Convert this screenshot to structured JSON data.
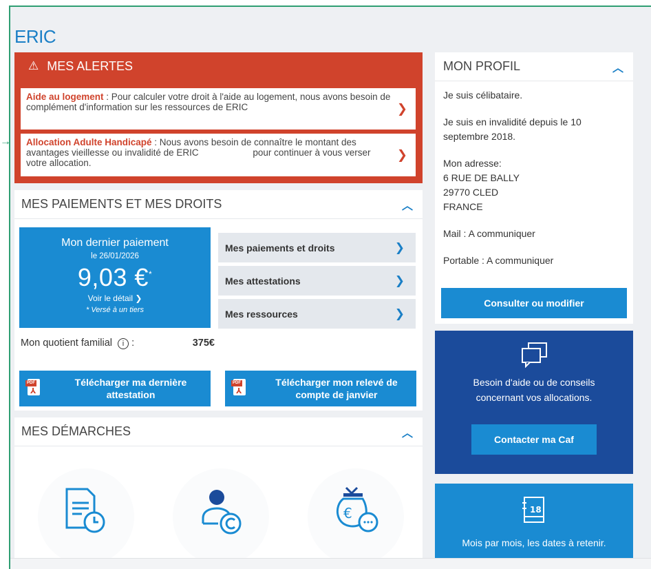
{
  "user": {
    "name": "ERIC"
  },
  "alerts": {
    "title": "MES ALERTES",
    "items": [
      {
        "title": "Aide au logement",
        "sep": " : ",
        "text": "Pour calculer votre droit à l'aide au logement, nous avons besoin de complément d'information sur les ressources de ERIC"
      },
      {
        "title": "Allocation Adulte Handicapé",
        "sep": " : ",
        "text": "Nous avons besoin de connaître le montant des avantages vieillesse ou invalidité de ERIC                     pour continuer à vous verser votre allocation."
      }
    ]
  },
  "payments": {
    "title": "MES PAIEMENTS ET MES DROITS",
    "last": {
      "label": "Mon dernier paiement",
      "date": "le 26/01/2026",
      "amount": "9,03 €",
      "marker": "*",
      "detail": "Voir le détail",
      "note": "* Versé à un tiers"
    },
    "links": [
      "Mes paiements et droits",
      "Mes attestations",
      "Mes ressources"
    ],
    "quotient": {
      "label": "Mon quotient familial",
      "suffix": ":",
      "value": "375€"
    },
    "downloads": [
      {
        "label": "Télécharger ma dernière attestation"
      },
      {
        "label": "Télécharger mon relevé de compte de janvier"
      }
    ]
  },
  "demarches": {
    "title": "MES DÉMARCHES"
  },
  "profile": {
    "title": "MON PROFIL",
    "status": "Je suis célibataire.",
    "invalidity": "Je suis en invalidité depuis le 10 septembre 2018.",
    "address_label": "Mon adresse:",
    "address_lines": [
      "6 RUE DE BALLY",
      "29770 CLED",
      "FRANCE"
    ],
    "mail": "Mail : A communiquer",
    "mobile": "Portable : A communiquer",
    "button": "Consulter ou modifier"
  },
  "help": {
    "message_line1": "Besoin d'aide ou de conseils",
    "message_line2": "concernant vos allocations.",
    "button": "Contacter ma Caf"
  },
  "calendar": {
    "day": "18",
    "caption": "Mois par mois, les dates à retenir."
  },
  "colors": {
    "accent": "#1a8bd2",
    "alert": "#d0432c",
    "help_bg": "#1b4b9b",
    "frame": "#2e9e72"
  }
}
